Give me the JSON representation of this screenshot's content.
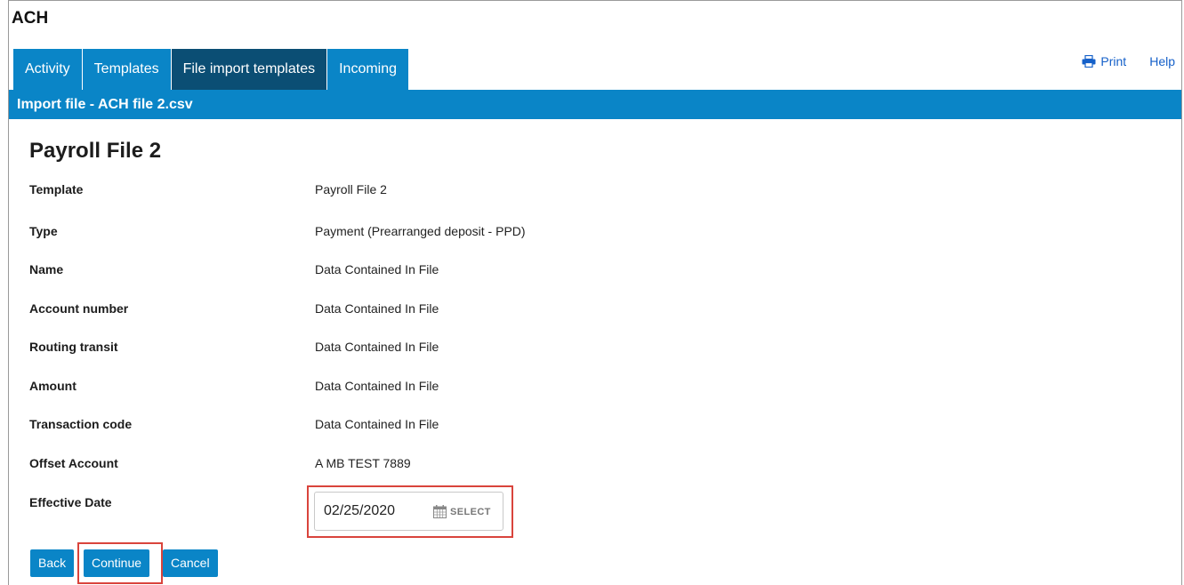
{
  "app": {
    "title": "ACH"
  },
  "tabs": [
    {
      "label": "Activity",
      "active": false
    },
    {
      "label": "Templates",
      "active": false
    },
    {
      "label": "File import templates",
      "active": true
    },
    {
      "label": "Incoming",
      "active": false
    }
  ],
  "utility": {
    "print_label": "Print",
    "print_icon": "printer-icon",
    "help_label": "Help"
  },
  "section": {
    "title": "Import file - ACH file 2.csv"
  },
  "page": {
    "title": "Payroll File 2"
  },
  "details": [
    {
      "label": "Template",
      "value": "Payroll File 2"
    },
    {
      "label": "Type",
      "value": "Payment (Prearranged deposit - PPD)"
    },
    {
      "label": "Name",
      "value": "Data Contained In File"
    },
    {
      "label": "Account number",
      "value": "Data Contained In File"
    },
    {
      "label": "Routing transit",
      "value": "Data Contained In File"
    },
    {
      "label": "Amount",
      "value": "Data Contained In File"
    },
    {
      "label": "Transaction code",
      "value": "Data Contained In File"
    },
    {
      "label": "Offset Account",
      "value": "A MB TEST 7889"
    }
  ],
  "effective_date": {
    "label": "Effective Date",
    "value": "02/25/2020",
    "select_label": "SELECT",
    "select_icon": "calendar-icon"
  },
  "buttons": {
    "back": "Back",
    "continue": "Continue",
    "cancel": "Cancel"
  },
  "colors": {
    "primary": "#0a85c7",
    "active_tab": "#0b4e74",
    "link": "#1560c9",
    "highlight": "#d9443c"
  }
}
